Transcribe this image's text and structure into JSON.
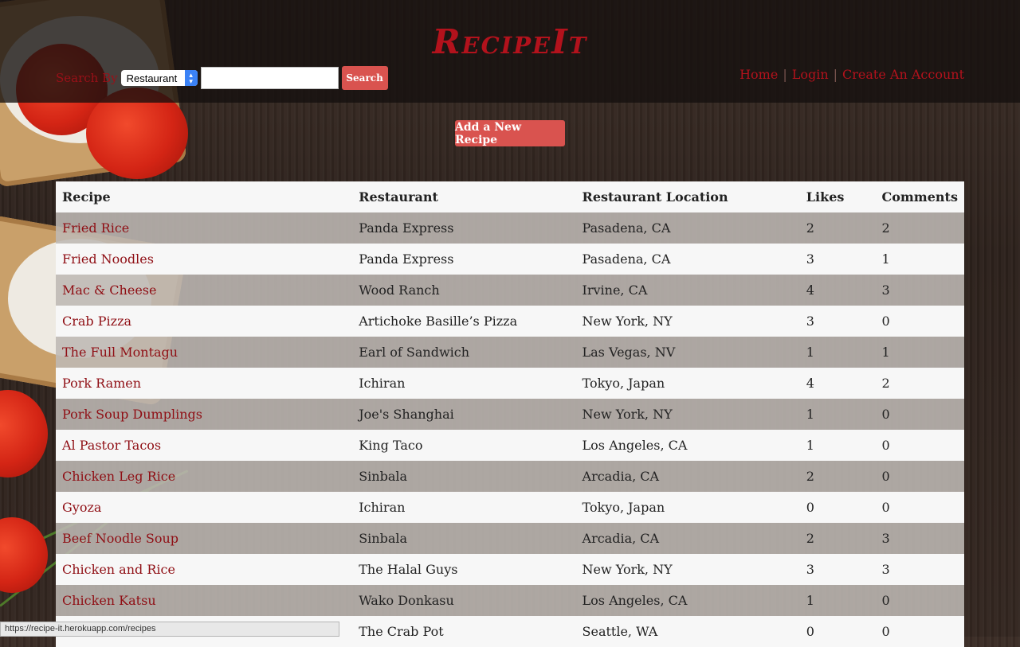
{
  "header": {
    "logo": "RecipeIt",
    "search_label": "Search By",
    "search_select_value": "Restaurant",
    "search_input_value": "",
    "search_button": "Search",
    "nav": {
      "home": "Home",
      "login": "Login",
      "create_account": "Create An Account"
    }
  },
  "actions": {
    "add_recipe": "Add a New Recipe"
  },
  "table": {
    "headers": [
      "Recipe",
      "Restaurant",
      "Restaurant Location",
      "Likes",
      "Comments"
    ],
    "rows": [
      {
        "recipe": "Fried Rice",
        "restaurant": "Panda Express",
        "location": "Pasadena, CA",
        "likes": "2",
        "comments": "2"
      },
      {
        "recipe": "Fried Noodles",
        "restaurant": "Panda Express",
        "location": "Pasadena, CA",
        "likes": "3",
        "comments": "1"
      },
      {
        "recipe": "Mac & Cheese",
        "restaurant": "Wood Ranch",
        "location": "Irvine, CA",
        "likes": "4",
        "comments": "3"
      },
      {
        "recipe": "Crab Pizza",
        "restaurant": "Artichoke Basille’s Pizza",
        "location": "New York, NY",
        "likes": "3",
        "comments": "0"
      },
      {
        "recipe": "The Full Montagu",
        "restaurant": "Earl of Sandwich",
        "location": "Las Vegas, NV",
        "likes": "1",
        "comments": "1"
      },
      {
        "recipe": "Pork Ramen",
        "restaurant": "Ichiran",
        "location": "Tokyo, Japan",
        "likes": "4",
        "comments": "2"
      },
      {
        "recipe": "Pork Soup Dumplings",
        "restaurant": "Joe's Shanghai",
        "location": "New York, NY",
        "likes": "1",
        "comments": "0"
      },
      {
        "recipe": "Al Pastor Tacos",
        "restaurant": "King Taco",
        "location": "Los Angeles, CA",
        "likes": "1",
        "comments": "0"
      },
      {
        "recipe": "Chicken Leg Rice",
        "restaurant": "Sinbala",
        "location": "Arcadia, CA",
        "likes": "2",
        "comments": "0"
      },
      {
        "recipe": "Gyoza",
        "restaurant": "Ichiran",
        "location": "Tokyo, Japan",
        "likes": "0",
        "comments": "0"
      },
      {
        "recipe": "Beef Noodle Soup",
        "restaurant": "Sinbala",
        "location": "Arcadia, CA",
        "likes": "2",
        "comments": "3"
      },
      {
        "recipe": "Chicken and Rice",
        "restaurant": "The Halal Guys",
        "location": "New York, NY",
        "likes": "3",
        "comments": "3"
      },
      {
        "recipe": "Chicken Katsu",
        "restaurant": "Wako Donkasu",
        "location": "Los Angeles, CA",
        "likes": "1",
        "comments": "0"
      },
      {
        "recipe": "",
        "restaurant": "The Crab Pot",
        "location": "Seattle, WA",
        "likes": "0",
        "comments": "0"
      }
    ]
  },
  "status_bar": {
    "url": "https://recipe-it.herokuapp.com/recipes"
  }
}
